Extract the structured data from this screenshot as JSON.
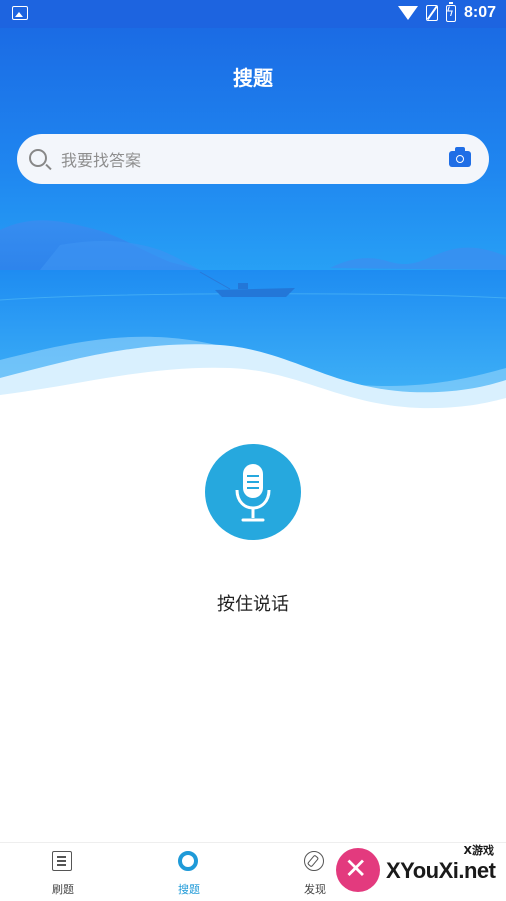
{
  "status_bar": {
    "time": "8:07"
  },
  "header": {
    "title": "搜题"
  },
  "search": {
    "placeholder": "我要找答案",
    "value": ""
  },
  "voice": {
    "label": "按住说话"
  },
  "bottom_nav": {
    "items": [
      {
        "label": "刷题",
        "icon": "list-icon",
        "active": false
      },
      {
        "label": "搜题",
        "icon": "search-tab-icon",
        "active": true
      },
      {
        "label": "发现",
        "icon": "compass-icon",
        "active": false
      }
    ]
  },
  "watermark": {
    "site": "XYouXi.net",
    "small": "X游戏"
  },
  "colors": {
    "primary": "#1d64e0",
    "accent": "#26a8de",
    "active_tab": "#1f9ad8"
  }
}
